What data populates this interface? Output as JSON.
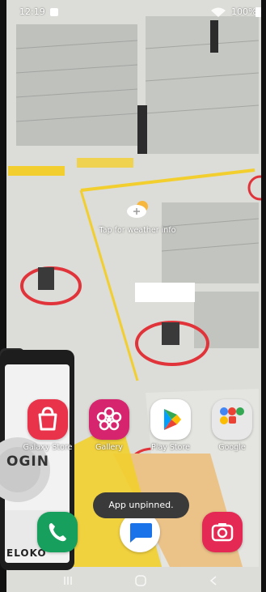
{
  "status_bar": {
    "time": "12:19",
    "battery": "100%",
    "notification_icon": "image-icon",
    "signal_icon": "wifi-signal-icon",
    "battery_icon": "battery-full-icon"
  },
  "weather": {
    "label": "Tap for weather info",
    "icon": "weather-plus-icon"
  },
  "phone_ui": {
    "login_text": "OGIN",
    "brand_text": "ELOKO"
  },
  "apps_row": [
    {
      "label": "Galaxy Store",
      "icon": "shopping-bag-icon",
      "color": "#e8334a"
    },
    {
      "label": "Gallery",
      "icon": "flower-icon",
      "color": "#d6246e"
    },
    {
      "label": "Play Store",
      "icon": "play-triangle-icon",
      "color": "#ffffff"
    },
    {
      "label": "Google",
      "icon": "google-folder-icon",
      "color": "#e8e8e8"
    }
  ],
  "dock": [
    {
      "icon": "phone-icon",
      "color": "#17a05d"
    },
    {
      "icon": "messages-icon",
      "color": "#1a73e8"
    },
    {
      "icon": "camera-icon",
      "color": "#e42a54"
    }
  ],
  "toast": {
    "text": "App unpinned."
  },
  "nav": {
    "recents": "recents-icon",
    "home": "home-icon",
    "back": "back-icon"
  }
}
